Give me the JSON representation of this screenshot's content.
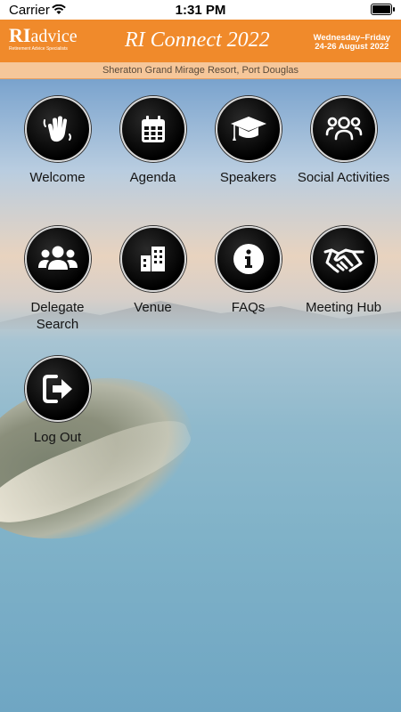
{
  "status_bar": {
    "carrier": "Carrier",
    "time": "1:31 PM"
  },
  "header": {
    "logo_main": "RI",
    "logo_suffix": "advice",
    "logo_sub": "Retirement Advice Specialists",
    "title": "RI Connect 2022",
    "date_line1": "Wednesday–Friday",
    "date_line2": "24-26 August 2022"
  },
  "venue": "Sheraton Grand Mirage Resort, Port Douglas",
  "menu": [
    {
      "label": "Welcome",
      "icon": "waving-hand-icon"
    },
    {
      "label": "Agenda",
      "icon": "calendar-icon"
    },
    {
      "label": "Speakers",
      "icon": "graduation-cap-icon"
    },
    {
      "label": "Social Activities",
      "icon": "group-users-icon"
    },
    {
      "label": "Delegate Search",
      "icon": "users-icon"
    },
    {
      "label": "Venue",
      "icon": "building-icon"
    },
    {
      "label": "FAQs",
      "icon": "info-icon"
    },
    {
      "label": "Meeting Hub",
      "icon": "handshake-icon"
    },
    {
      "label": "Log Out",
      "icon": "logout-icon"
    }
  ],
  "colors": {
    "header": "#f08a2b",
    "venue_bar": "#f6c79a",
    "icon_circle": "#000000"
  }
}
